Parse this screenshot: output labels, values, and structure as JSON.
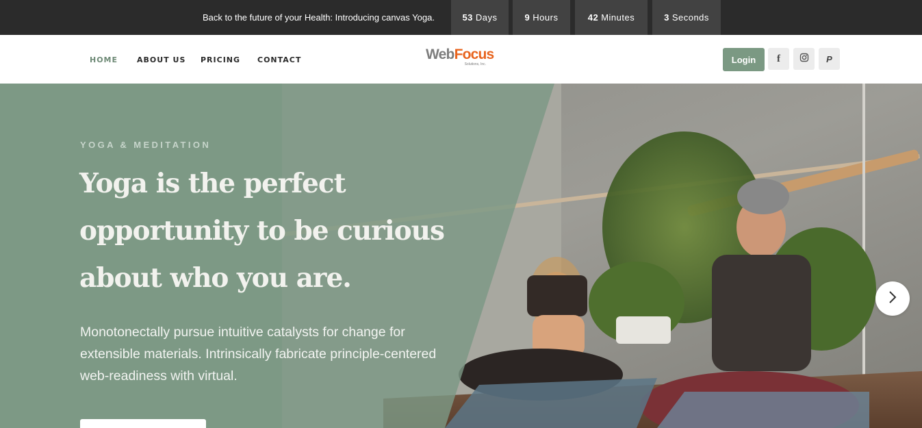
{
  "announcement": {
    "text": "Back to the future of your Health: Introducing canvas Yoga.",
    "countdown": [
      {
        "value": "53",
        "unit": "Days"
      },
      {
        "value": "9",
        "unit": "Hours"
      },
      {
        "value": "42",
        "unit": "Minutes"
      },
      {
        "value": "3",
        "unit": "Seconds"
      }
    ]
  },
  "nav": {
    "items": [
      {
        "label": "HOME",
        "active": true
      },
      {
        "label": "ABOUT US",
        "active": false
      },
      {
        "label": "PRICING",
        "active": false
      },
      {
        "label": "CONTACT",
        "active": false
      }
    ]
  },
  "logo": {
    "web": "Web",
    "focus": "Focus",
    "sub": "Solutions, Inc."
  },
  "header": {
    "login_label": "Login",
    "social": [
      {
        "icon": "facebook-icon",
        "glyph": "f"
      },
      {
        "icon": "instagram-icon",
        "glyph": ""
      },
      {
        "icon": "paypal-icon",
        "glyph": "P"
      }
    ]
  },
  "hero": {
    "kicker": "YOGA & MEDITATION",
    "headline": "Yoga is the perfect opportunity to be curious about who you are.",
    "body": "Monotonectally pursue intuitive catalysts for change for extensible materials. Intrinsically fabricate principle-centered web-readiness with virtual.",
    "next_icon": "chevron-right-icon"
  },
  "colors": {
    "accent": "#7b9983",
    "topbar": "#2b2b2b",
    "countdown_box": "#424242",
    "logo_orange": "#e8641e"
  }
}
